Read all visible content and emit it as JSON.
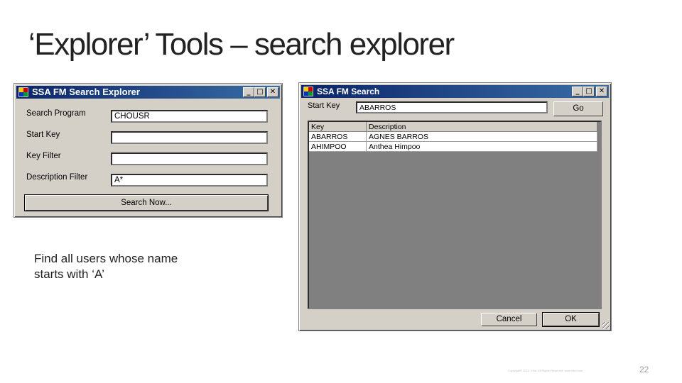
{
  "slide": {
    "title": "‘Explorer’ Tools – search explorer",
    "caption_line1": "Find all users whose name",
    "caption_line2": "starts with ‘A’",
    "copyright": "Copyright© 2013, Infor. All Rights Reserved. www.infor.com",
    "page_number": "22"
  },
  "left_window": {
    "title": "SSA FM Search Explorer",
    "labels": {
      "search_program": "Search Program",
      "start_key": "Start Key",
      "key_filter": "Key Filter",
      "description_filter": "Description Filter"
    },
    "values": {
      "search_program": "CHOUSR",
      "start_key": "",
      "key_filter": "",
      "description_filter": "A*"
    },
    "search_button": "Search Now..."
  },
  "right_window": {
    "title": "SSA FM Search",
    "start_key_label": "Start Key",
    "start_key_value": "ABARROS",
    "go_button": "Go",
    "columns": [
      "Key",
      "Description"
    ],
    "rows": [
      [
        "ABARROS",
        "AGNES BARROS"
      ],
      [
        "AHIMPOO",
        "Anthea Himpoo"
      ]
    ],
    "cancel_button": "Cancel",
    "ok_button": "OK"
  },
  "titlebar_buttons": {
    "minimize": "_",
    "maximize": "□",
    "close": "✕"
  }
}
